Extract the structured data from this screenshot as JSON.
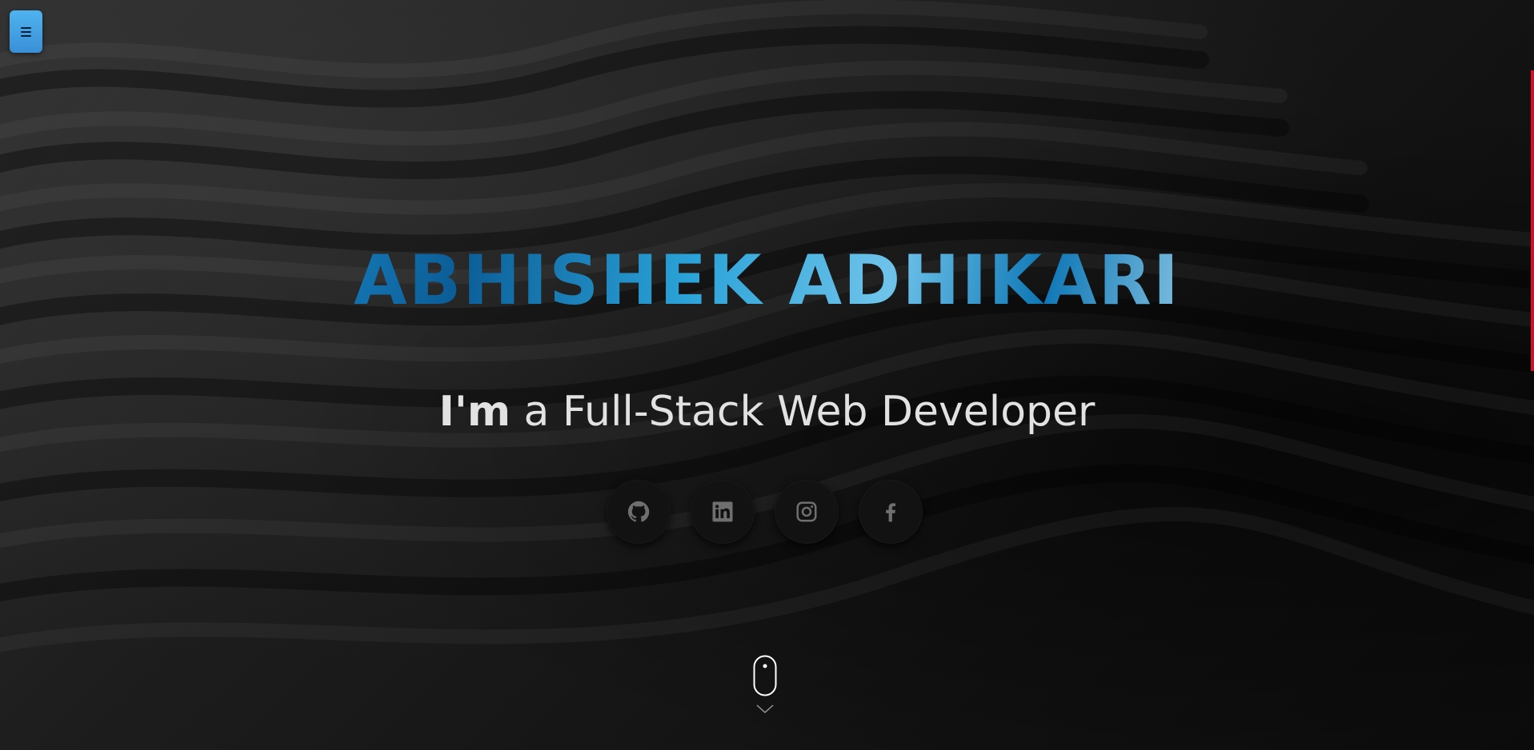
{
  "menu": {
    "icon": "hamburger-icon",
    "accent_color": "#4fb3f0"
  },
  "hero": {
    "name": "ABHISHEK ADHIKARI",
    "subtitle_strong": "I'm",
    "subtitle_rest": " a Full-Stack Web Developer"
  },
  "socials": [
    {
      "name": "github",
      "icon": "github-icon"
    },
    {
      "name": "linkedin",
      "icon": "linkedin-icon"
    },
    {
      "name": "instagram",
      "icon": "instagram-icon"
    },
    {
      "name": "facebook",
      "icon": "facebook-icon"
    }
  ],
  "scroll_indicator": {
    "icon": "mouse-scroll-icon",
    "chevron_icon": "chevron-down-icon"
  },
  "colors": {
    "background": "#141414",
    "scrollbar_accent": "#d0112b",
    "text": "#e2e2e2",
    "title_blue": "#2a8ec8"
  }
}
